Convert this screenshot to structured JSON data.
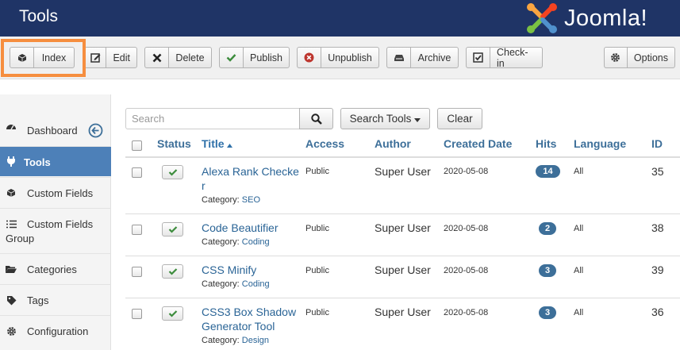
{
  "header": {
    "title": "Tools",
    "brand": "Joomla!",
    "brand_colors": [
      "#f9a541",
      "#f44321",
      "#5091cd",
      "#7ac143"
    ]
  },
  "toolbar": {
    "buttons": [
      {
        "icon": "cube-icon",
        "label": "Index"
      },
      {
        "icon": "edit-icon",
        "label": "Edit"
      },
      {
        "icon": "delete-icon",
        "label": "Delete"
      },
      {
        "icon": "check-icon",
        "label": "Publish"
      },
      {
        "icon": "unpublish-icon",
        "label": "Unpublish"
      },
      {
        "icon": "archive-icon",
        "label": "Archive"
      },
      {
        "icon": "checkin-icon",
        "label": "Check-in"
      },
      {
        "icon": "gear-icon",
        "label": "Options"
      }
    ],
    "highlight_color": "#f68e3f"
  },
  "sidebar": {
    "items": [
      {
        "label": "Dashboard",
        "icon": "dashboard-icon"
      },
      {
        "label": "Tools",
        "icon": "plug-icon",
        "active": true
      },
      {
        "label": "Custom Fields",
        "icon": "cube-icon"
      },
      {
        "label_line1": "Custom Fields",
        "label_line2": "Group",
        "icon": "list-icon"
      },
      {
        "label": "Categories",
        "icon": "folder-icon"
      },
      {
        "label": "Tags",
        "icon": "tag-icon"
      },
      {
        "label": "Configuration",
        "icon": "gear-icon"
      }
    ],
    "active_color": "#4d80b8"
  },
  "filters": {
    "search_placeholder": "Search",
    "search_tools_label": "Search Tools",
    "clear_label": "Clear"
  },
  "table": {
    "headers": {
      "status": "Status",
      "title": "Title",
      "access": "Access",
      "author": "Author",
      "created": "Created Date",
      "hits": "Hits",
      "language": "Language",
      "id": "ID"
    },
    "category_label": "Category:",
    "rows": [
      {
        "title_line1": "Alexa Rank Checke",
        "title_line2": "r",
        "category": "SEO",
        "access": "Public",
        "author": "Super User",
        "date": "2020-05-08",
        "hits": "14",
        "language": "All",
        "id": "35"
      },
      {
        "title_line1": "Code Beautifier",
        "category": "Coding",
        "access": "Public",
        "author": "Super User",
        "date": "2020-05-08",
        "hits": "2",
        "language": "All",
        "id": "38"
      },
      {
        "title_line1": "CSS Minify",
        "category": "Coding",
        "access": "Public",
        "author": "Super User",
        "date": "2020-05-08",
        "hits": "3",
        "language": "All",
        "id": "39"
      },
      {
        "title_line1": "CSS3 Box Shadow",
        "title_line2": "Generator Tool",
        "category": "Design",
        "access": "Public",
        "author": "Super User",
        "date": "2020-05-08",
        "hits": "3",
        "language": "All",
        "id": "36"
      }
    ]
  }
}
